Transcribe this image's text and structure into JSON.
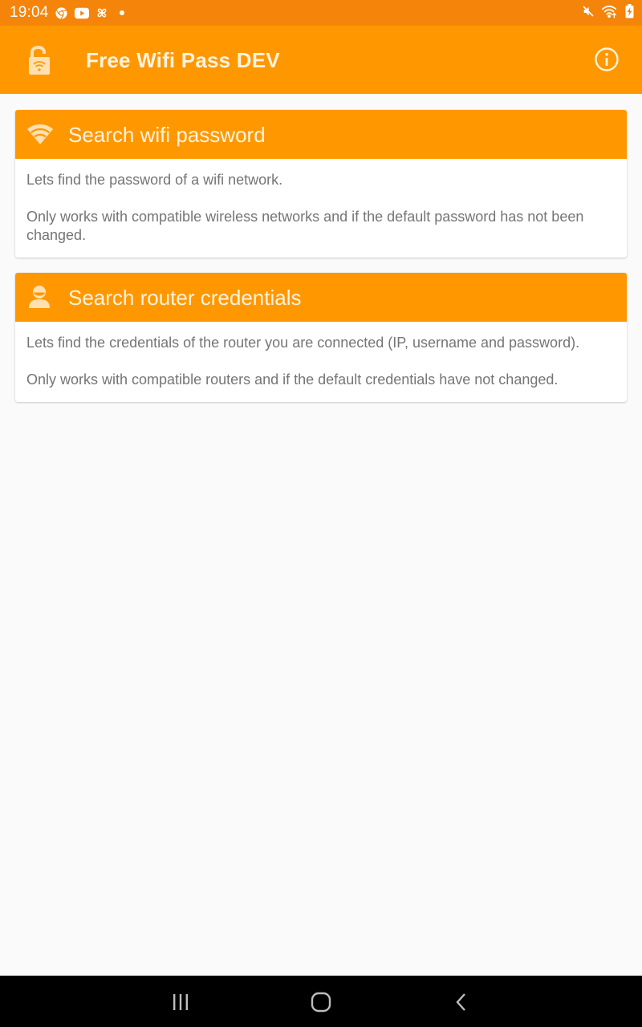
{
  "status_bar": {
    "time": "19:04",
    "left_icons": [
      "chrome-icon",
      "youtube-icon",
      "pinwheel-app-icon",
      "notification-dot-icon"
    ],
    "right_icons": [
      "mute-icon",
      "wifi-data-icon",
      "battery-charging-icon"
    ]
  },
  "app_bar": {
    "title": "Free Wifi Pass DEV",
    "logo_icon": "lock-wifi-icon",
    "action_icon": "info-icon"
  },
  "cards": [
    {
      "title": "Search wifi password",
      "icon": "wifi-icon",
      "paragraphs": [
        "Lets find the password of a wifi network.",
        "Only works with compatible wireless networks and if the default password has not been changed."
      ]
    },
    {
      "title": "Search router credentials",
      "icon": "user-icon",
      "paragraphs": [
        "Lets find the credentials of the router you are connected (IP, username and password).",
        "Only works with compatible routers and if the default credentials have not changed."
      ]
    }
  ],
  "nav_bar": {
    "buttons": [
      "recents",
      "home",
      "back"
    ]
  },
  "colors": {
    "status_bar": "#f5840b",
    "primary": "#ff9800",
    "on_primary": "#fff3e0",
    "background": "#fafafa",
    "body_text": "#757575"
  }
}
